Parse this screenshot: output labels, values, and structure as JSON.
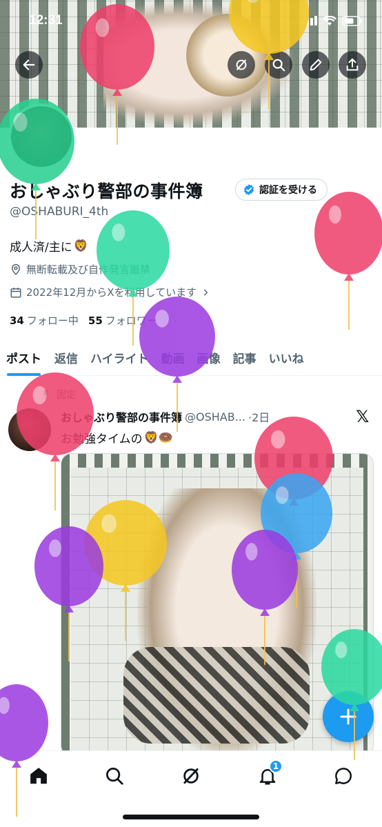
{
  "status_bar": {
    "time": "12:31"
  },
  "profile": {
    "name": "おしゃぶり警部の事件簿",
    "verify_label": "認証を受ける",
    "handle": "@OSHABURI_4th",
    "bio": "成人済/主に",
    "bio_emoji": "🦁",
    "location": "無断転載及び自作発言厳禁",
    "joined": "2022年12月からXを利用しています",
    "following_count": "34",
    "following_label": "フォロー中",
    "followers_count": "55",
    "followers_label": "フォロワー"
  },
  "tabs": [
    {
      "label": "ポスト",
      "active": true
    },
    {
      "label": "返信"
    },
    {
      "label": "ハイライト"
    },
    {
      "label": "動画"
    },
    {
      "label": "画像"
    },
    {
      "label": "記事"
    },
    {
      "label": "いいね"
    }
  ],
  "post": {
    "pinned_label": "固定",
    "author_name": "おしゃぶり警部の事件簿",
    "author_handle": "@OSHAB...",
    "time": "·2日",
    "text": "お勉強タイムの",
    "emoji": "🦁🍩",
    "x_mark": "𝕏"
  },
  "nav": {
    "notification_badge": "1"
  },
  "colors": {
    "accent": "#1d9bf0",
    "text": "#0f1419",
    "secondary": "#536471"
  },
  "balloons": [
    {
      "color": "#ee3f6b"
    },
    {
      "color": "#f5c721"
    },
    {
      "color": "#27cf8f"
    },
    {
      "color": "#ee3f6b"
    },
    {
      "color": "#2bd9a0"
    },
    {
      "color": "#9b3be0"
    },
    {
      "color": "#ee3f6b"
    },
    {
      "color": "#ee3f6b"
    },
    {
      "color": "#3aa6f2"
    },
    {
      "color": "#f5c721"
    },
    {
      "color": "#9b3be0"
    },
    {
      "color": "#9b3be0"
    },
    {
      "color": "#2bd9a0"
    },
    {
      "color": "#9b3be0"
    }
  ]
}
